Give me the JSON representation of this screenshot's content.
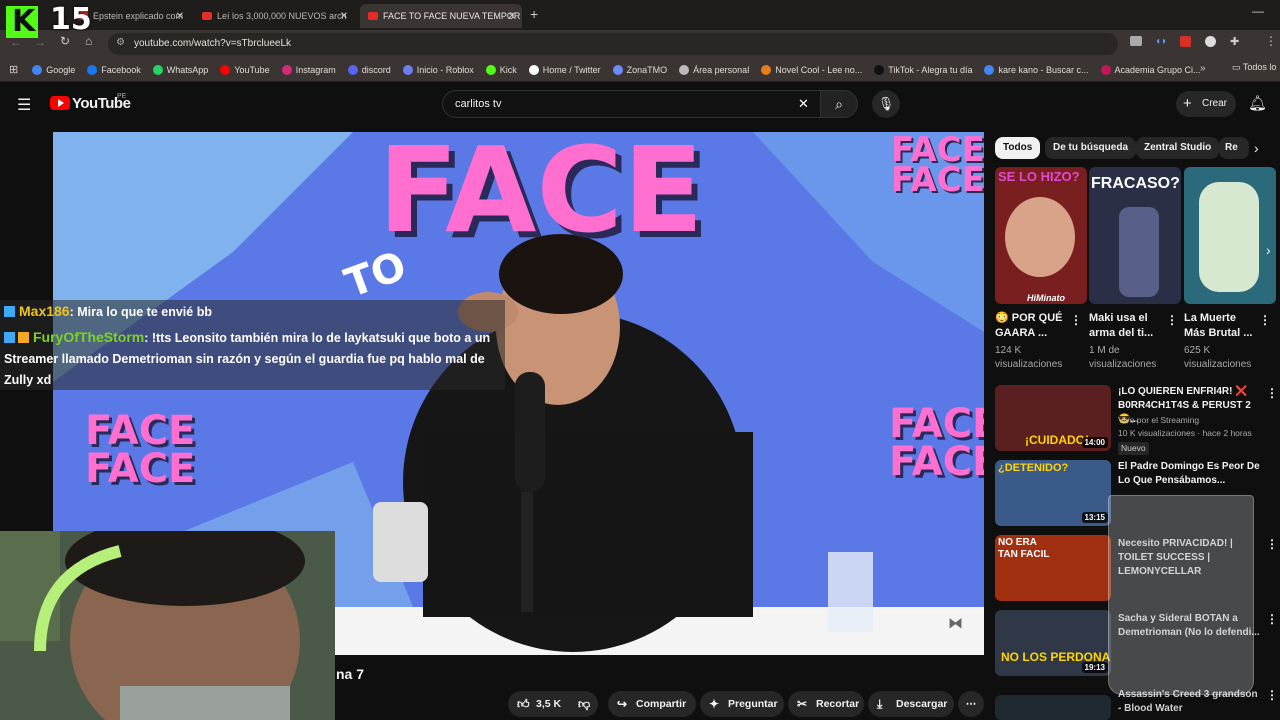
{
  "stream_overlay": {
    "counter": "15"
  },
  "browser": {
    "tabs": [
      {
        "label": "Epstein explicado com"
      },
      {
        "label": "Leí los 3,000,000 NUEVOS arch"
      },
      {
        "label": "FACE TO FACE NUEVA TEMPOR"
      }
    ],
    "new_tab": "+",
    "url": "youtube.com/watch?v=sTbrclueeLk",
    "bookmarks": [
      {
        "label": "Google",
        "color": "#4285f4"
      },
      {
        "label": "Facebook",
        "color": "#1877f2"
      },
      {
        "label": "WhatsApp",
        "color": "#25d366"
      },
      {
        "label": "YouTube",
        "color": "#ff0000"
      },
      {
        "label": "Instagram",
        "color": "#d62976"
      },
      {
        "label": "discord",
        "color": "#5865f2"
      },
      {
        "label": "Inicio - Roblox",
        "color": "#6a7ff0"
      },
      {
        "label": "Kick",
        "color": "#53fc18"
      },
      {
        "label": "Home / Twitter",
        "color": "#ffffff"
      },
      {
        "label": "ZonaTMO",
        "color": "#6a8cff"
      },
      {
        "label": "Área personal",
        "color": "#bbbbbb"
      },
      {
        "label": "Novel Cool - Lee no...",
        "color": "#e87c1e"
      },
      {
        "label": "TikTok - Alegra tu día",
        "color": "#111111"
      },
      {
        "label": "kare kano - Buscar c...",
        "color": "#4285f4"
      },
      {
        "label": "Academia Grupo Ci...",
        "color": "#c2185b"
      }
    ],
    "all_bookmarks": "Todos lo"
  },
  "youtube": {
    "logo_text": "YouTube",
    "logo_region": "PE",
    "search_value": "carlitos tv",
    "create_label": "Crear"
  },
  "video": {
    "brand_top": "FACE",
    "brand_bottom": "FACE",
    "brand_to": "TO",
    "title_fragment": "na 7"
  },
  "chat": [
    {
      "user": "Max186",
      "message": ": Mira lo que te envié bb",
      "user_color": "#f0c419"
    },
    {
      "user": "FuryOfTheStorm",
      "message": ": !tts Leonsito también mira lo de laykatsuki que boto a un Streamer llamado Demetrioman sin razón y según el guardia fue pq hablo mal de Zully xd",
      "user_color": "#7ed321"
    }
  ],
  "actions": {
    "likes": "3,5 K",
    "share": "Compartir",
    "ask": "Preguntar",
    "clip": "Recortar",
    "download": "Descargar"
  },
  "chips": [
    "Todos",
    "De tu búsqueda",
    "Zentral Studio",
    "Re"
  ],
  "shorts": [
    {
      "thumb_text": "SE LO HIZO?",
      "thumb_sub": "HiMinato",
      "title": "😳 POR QUÉ GAARA ...",
      "views": "124 K",
      "views_label": "visualizaciones",
      "color": "#7a1f1f"
    },
    {
      "thumb_text": "FRACASO?",
      "title": "Maki usa el arma del ti...",
      "views": "1 M de",
      "views_label": "visualizaciones",
      "color": "#2a2f45"
    },
    {
      "title": "La Muerte Más Brutal ...",
      "views": "625 K",
      "views_label": "visualizaciones",
      "color": "#2b6a7a"
    }
  ],
  "recommended": [
    {
      "title": "¡LO QUIEREN ENFRI4R! ❌ B0RR4CH1T4S & PERUST 2 😎...",
      "channel": "Vivo por el Streaming",
      "meta": "10 K visualizaciones · hace 2 horas",
      "badge": "Nuevo",
      "duration": "14:00",
      "thumb_text": "¡CUIDADO!",
      "color": "#5a2020"
    },
    {
      "title": "El Padre Domingo Es Peor De Lo Que Pensábamos...",
      "duration": "13:15",
      "thumb_text": "¿DETENIDO?",
      "color": "#3a5a8a"
    },
    {
      "title": "Necesito PRIVACIDAD! | TOILET SUCCESS | LEMONYCELLAR",
      "duration": "",
      "thumb_text": "NO ERA TAN FACIL",
      "color": "#a03010"
    },
    {
      "title": "Sacha y Sideral BOTAN a Demetrioman (No lo defendi...",
      "duration": "19:13",
      "thumb_text": "NO LOS PERDONA",
      "color": "#303848"
    },
    {
      "title": "Assassin's Creed 3 grandson - Blood Water",
      "duration": "",
      "thumb_text": "",
      "color": "#1f2a30"
    }
  ]
}
